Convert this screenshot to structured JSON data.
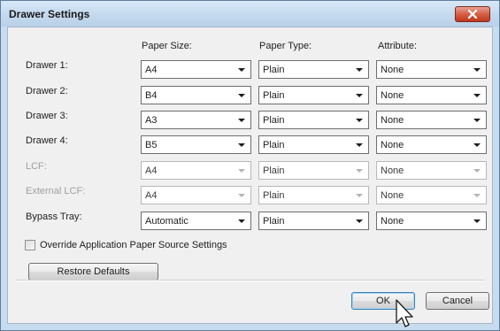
{
  "window": {
    "title": "Drawer Settings",
    "close_icon": "close-icon"
  },
  "columns": {
    "paper_size": "Paper Size:",
    "paper_type": "Paper Type:",
    "attribute": "Attribute:"
  },
  "rows": [
    {
      "label": "Drawer 1:",
      "size": "A4",
      "type": "Plain",
      "attribute": "None",
      "enabled": true
    },
    {
      "label": "Drawer 2:",
      "size": "B4",
      "type": "Plain",
      "attribute": "None",
      "enabled": true
    },
    {
      "label": "Drawer 3:",
      "size": "A3",
      "type": "Plain",
      "attribute": "None",
      "enabled": true
    },
    {
      "label": "Drawer 4:",
      "size": "B5",
      "type": "Plain",
      "attribute": "None",
      "enabled": true
    },
    {
      "label": "LCF:",
      "size": "A4",
      "type": "Plain",
      "attribute": "None",
      "enabled": false
    },
    {
      "label": "External LCF:",
      "size": "A4",
      "type": "Plain",
      "attribute": "None",
      "enabled": false
    },
    {
      "label": "Bypass Tray:",
      "size": "Automatic",
      "type": "Plain",
      "attribute": "None",
      "enabled": true
    }
  ],
  "override": {
    "label": "Override Application Paper Source Settings",
    "checked": false
  },
  "buttons": {
    "restore_defaults": "Restore Defaults",
    "ok": "OK",
    "cancel": "Cancel"
  }
}
